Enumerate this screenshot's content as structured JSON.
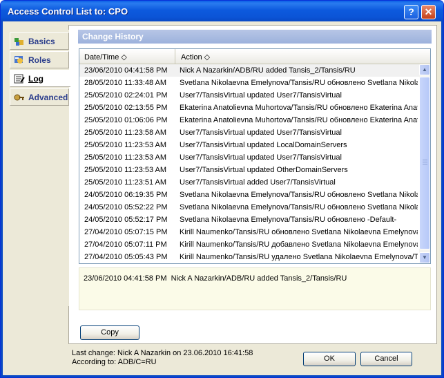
{
  "window": {
    "title": "Access Control List to: CPO",
    "help_label": "?",
    "close_label": "✕"
  },
  "nav": {
    "items": [
      {
        "label": "Basics",
        "icon": "basics-icon"
      },
      {
        "label": "Roles",
        "icon": "roles-icon"
      },
      {
        "label": "Log",
        "icon": "log-icon",
        "active": true
      },
      {
        "label": "Advanced",
        "icon": "advanced-icon"
      }
    ]
  },
  "section": {
    "title": "Change History"
  },
  "grid": {
    "columns": [
      "Date/Time ◇",
      "Action ◇"
    ],
    "rows": [
      {
        "date": "23/06/2010 04:41:58 PM",
        "action": "Nick A Nazarkin/ADB/RU added Tansis_2/Tansis/RU"
      },
      {
        "date": "28/05/2010 11:33:48 AM",
        "action": "Svetlana Nikolaevna Emelynova/Tansis/RU обновлено Svetlana Nikola"
      },
      {
        "date": "25/05/2010 02:24:01 PM",
        "action": "User7/TansisVirtual updated User7/TansisVirtual"
      },
      {
        "date": "25/05/2010 02:13:55 PM",
        "action": "Ekaterina Anatolievna Muhortova/Tansis/RU обновлено Ekaterina Anat"
      },
      {
        "date": "25/05/2010 01:06:06 PM",
        "action": "Ekaterina Anatolievna Muhortova/Tansis/RU обновлено Ekaterina Anat"
      },
      {
        "date": "25/05/2010 11:23:58 AM",
        "action": "User7/TansisVirtual updated User7/TansisVirtual"
      },
      {
        "date": "25/05/2010 11:23:53 AM",
        "action": "User7/TansisVirtual updated LocalDomainServers"
      },
      {
        "date": "25/05/2010 11:23:53 AM",
        "action": "User7/TansisVirtual updated User7/TansisVirtual"
      },
      {
        "date": "25/05/2010 11:23:53 AM",
        "action": "User7/TansisVirtual updated OtherDomainServers"
      },
      {
        "date": "25/05/2010 11:23:51 AM",
        "action": "User7/TansisVirtual added User7/TansisVirtual"
      },
      {
        "date": "24/05/2010 06:19:35 PM",
        "action": "Svetlana Nikolaevna Emelynova/Tansis/RU обновлено Svetlana Nikola"
      },
      {
        "date": "24/05/2010 05:52:22 PM",
        "action": "Svetlana Nikolaevna Emelynova/Tansis/RU обновлено Svetlana Nikola"
      },
      {
        "date": "24/05/2010 05:52:17 PM",
        "action": "Svetlana Nikolaevna Emelynova/Tansis/RU обновлено -Default-"
      },
      {
        "date": "27/04/2010 05:07:15 PM",
        "action": "Kirill Naumenko/Tansis/RU обновлено Svetlana Nikolaevna Emelynova"
      },
      {
        "date": "27/04/2010 05:07:11 PM",
        "action": "Kirill Naumenko/Tansis/RU добавлено Svetlana Nikolaevna Emelynova"
      },
      {
        "date": "27/04/2010 05:05:43 PM",
        "action": "Kirill Naumenko/Tansis/RU удалено Svetlana Nikolaevna Emelynova/T"
      }
    ]
  },
  "detail": {
    "text": "23/06/2010 04:41:58 PM  Nick A Nazarkin/ADB/RU added Tansis_2/Tansis/RU"
  },
  "buttons": {
    "copy": "Copy",
    "ok": "OK",
    "cancel": "Cancel"
  },
  "footer": {
    "last_change": "Last change: Nick A Nazarkin on 23.06.2010 16:41:58",
    "according_to": "According to: ADB/C=RU"
  }
}
